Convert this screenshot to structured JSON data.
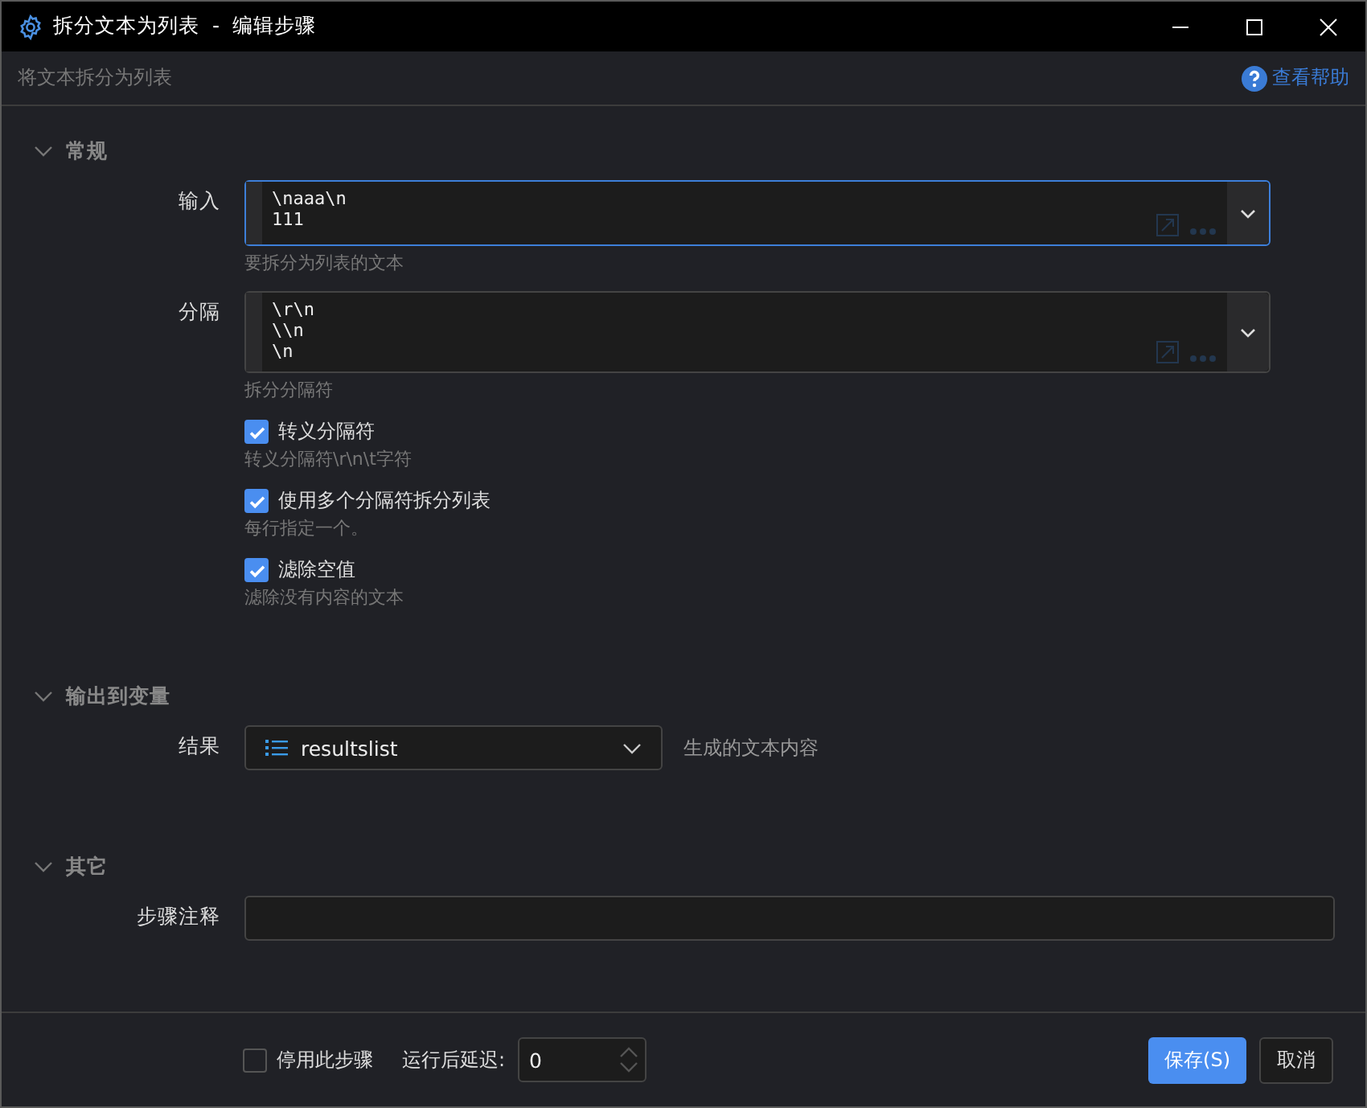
{
  "window": {
    "title": "拆分文本为列表  -  编辑步骤"
  },
  "header": {
    "description": "将文本拆分为列表",
    "help_link": "查看帮助"
  },
  "sections": [
    {
      "title": "常规",
      "expanded": true,
      "fields": [
        {
          "kind": "textarea",
          "label": "输入",
          "lines": [
            "\\naaa\\n",
            "111"
          ],
          "focused": true,
          "hint": "要拆分为列表的文本"
        },
        {
          "kind": "textarea",
          "label": "分隔",
          "lines": [
            "\\r\\n",
            "\\\\n",
            "\\n"
          ],
          "focused": false,
          "hint": "拆分分隔符"
        },
        {
          "kind": "checkbox",
          "label": "转义分隔符",
          "checked": true,
          "hint": "转义分隔符\\r\\n\\t字符"
        },
        {
          "kind": "checkbox",
          "label": "使用多个分隔符拆分列表",
          "checked": true,
          "hint": "每行指定一个。"
        },
        {
          "kind": "checkbox",
          "label": "滤除空值",
          "checked": true,
          "hint": "滤除没有内容的文本"
        }
      ]
    },
    {
      "title": "输出到变量",
      "expanded": true,
      "fields": [
        {
          "kind": "variable",
          "label": "结果",
          "value": "resultslist",
          "note": "生成的文本内容"
        }
      ]
    },
    {
      "title": "其它",
      "expanded": true,
      "fields": [
        {
          "kind": "text",
          "label": "步骤注释"
        }
      ]
    }
  ],
  "footer": {
    "disable_step": {
      "label": "停用此步骤",
      "checked": false
    },
    "delay_label": "运行后延迟:",
    "delay_value": "0",
    "buttons": [
      {
        "label": "保存(S)",
        "kind": "primary"
      },
      {
        "label": "取消",
        "kind": "secondary"
      }
    ]
  }
}
